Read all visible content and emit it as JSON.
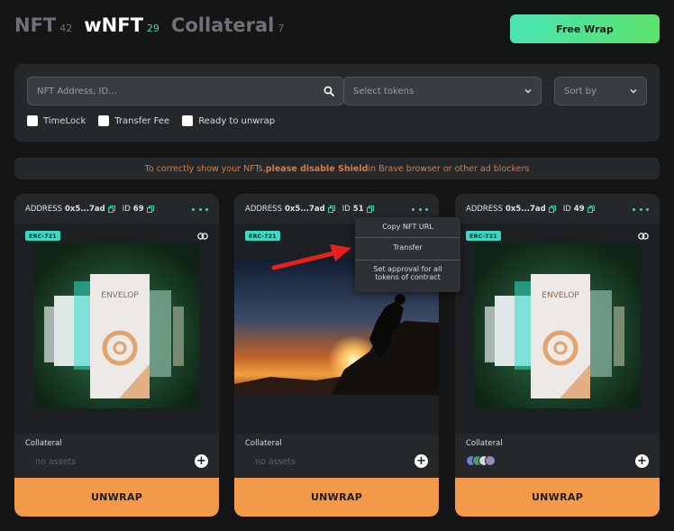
{
  "tabs": [
    {
      "name": "NFT",
      "count": "42",
      "active": false
    },
    {
      "name": "wNFT",
      "count": "29",
      "active": true
    },
    {
      "name": "Collateral",
      "count": "7",
      "active": false
    }
  ],
  "free_wrap_label": "Free Wrap",
  "filters": {
    "search_placeholder": "NFT Address, ID...",
    "tokens_select": "Select tokens",
    "sort_select": "Sort by",
    "checkboxes": [
      "TimeLock",
      "Transfer Fee",
      "Ready to unwrap"
    ]
  },
  "notice": {
    "before": "To correctly show your NFTs, ",
    "bold": "please disable Shield",
    "after": " in  Brave browser or other ad  blockers"
  },
  "cards": [
    {
      "address_label": "ADDRESS",
      "address": "0x5...7ad",
      "id_label": "ID",
      "id": "69",
      "standard": "ERC-721",
      "art_text": "ENVELOP",
      "collateral_label": "Collateral",
      "assets_text": "no assets",
      "unwrap_label": "UNWRAP"
    },
    {
      "address_label": "ADDRESS",
      "address": "0x5...7ad",
      "id_label": "ID",
      "id": "51",
      "standard": "ERC-721",
      "collateral_label": "Collateral",
      "assets_text": "no assets",
      "unwrap_label": "UNWRAP"
    },
    {
      "address_label": "ADDRESS",
      "address": "0x5...7ad",
      "id_label": "ID",
      "id": "49",
      "standard": "ERC-721",
      "art_text": "ENVELOP",
      "collateral_label": "Collateral",
      "unwrap_label": "UNWRAP"
    }
  ],
  "menu": {
    "copy_url": "Copy NFT URL",
    "transfer": "Transfer",
    "approval_line1": "Set approval for all",
    "approval_line2": "tokens of contract"
  },
  "colors": {
    "accent": "#3bd9a4",
    "unwrap": "#f2994a",
    "notice": "#d97c3f",
    "arrow": "#e8201c"
  },
  "icons": [
    "search-icon",
    "chevron-down-icon",
    "copy-icon",
    "more-dots-icon",
    "link-icon",
    "plus-icon",
    "arrow-annotation"
  ]
}
